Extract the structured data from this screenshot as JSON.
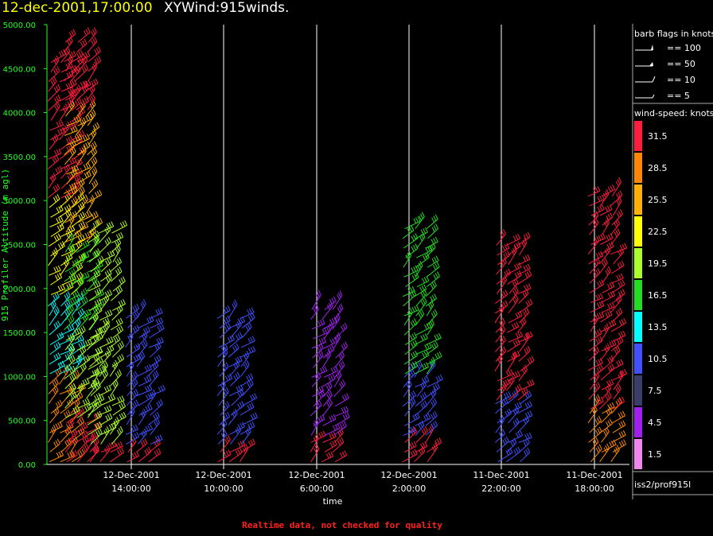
{
  "header": {
    "date": "12-dec-2001,17:00:00",
    "product": "XYWind:915winds."
  },
  "footer_note": "Realtime data, not checked for quality",
  "source": "iss2/prof915l",
  "legend": {
    "barb_title": "barb flags in knots",
    "barbs": [
      {
        "label": "== 100",
        "icon": "pennant"
      },
      {
        "label": "== 50",
        "icon": "triangle-flag"
      },
      {
        "label": "== 10",
        "icon": "full-barb"
      },
      {
        "label": "== 5",
        "icon": "half-barb"
      }
    ],
    "speed_title": "wind-speed: knots",
    "speed_bins": [
      {
        "label": "31.5",
        "color": "#ff1c3c"
      },
      {
        "label": "28.5",
        "color": "#ff8800"
      },
      {
        "label": "25.5",
        "color": "#ffb000"
      },
      {
        "label": "22.5",
        "color": "#ffff00"
      },
      {
        "label": "19.5",
        "color": "#aaff2a"
      },
      {
        "label": "16.5",
        "color": "#22dd22"
      },
      {
        "label": "13.5",
        "color": "#00ffff"
      },
      {
        "label": "10.5",
        "color": "#4050ff"
      },
      {
        "label": "7.5",
        "color": "#3c3c6c"
      },
      {
        "label": "4.5",
        "color": "#a020f0"
      },
      {
        "label": "1.5",
        "color": "#ee88ee"
      }
    ]
  },
  "chart_data": {
    "type": "scatter",
    "ylabel": "915 Profiler Altitude (m agl)",
    "xlabel": "time",
    "ylim": [
      0,
      5000
    ],
    "yticks": [
      "5000.00",
      "4500.00",
      "4000.00",
      "3500.00",
      "3000.00",
      "2500.00",
      "2000.00",
      "1500.00",
      "1000.00",
      "500.00",
      "0.00"
    ],
    "xticks": [
      {
        "date": "12-Dec-2001",
        "time": "14:00:00"
      },
      {
        "date": "12-Dec-2001",
        "time": "10:00:00"
      },
      {
        "date": "12-Dec-2001",
        "time": "6:00:00"
      },
      {
        "date": "12-Dec-2001",
        "time": "2:00:00"
      },
      {
        "date": "11-Dec-2001",
        "time": "22:00:00"
      },
      {
        "date": "11-Dec-2001",
        "time": "18:00:00"
      }
    ],
    "time_axis": "reversed, most recent at left",
    "grid": "vertical lines at tick times",
    "columns": [
      {
        "time": "17:00",
        "top_m": 4600,
        "bands": [
          [
            0,
            1000,
            "28.5"
          ],
          [
            1000,
            1900,
            "13.5"
          ],
          [
            1900,
            3000,
            "22.5"
          ],
          [
            3000,
            4600,
            "31.5"
          ]
        ]
      },
      {
        "time": "16:00",
        "top_m": 4900,
        "bands": [
          [
            0,
            500,
            "31.5"
          ],
          [
            500,
            1500,
            "19.5"
          ],
          [
            1500,
            2500,
            "16.5"
          ],
          [
            2500,
            4000,
            "25.5"
          ],
          [
            4000,
            4900,
            "31.5"
          ]
        ]
      },
      {
        "time": "15:00",
        "top_m": 2700,
        "bands": [
          [
            0,
            200,
            "31.5"
          ],
          [
            200,
            1500,
            "19.5"
          ],
          [
            1500,
            2700,
            "19.5"
          ]
        ]
      },
      {
        "time": "14:00",
        "top_m": 1700,
        "bands": [
          [
            0,
            200,
            "31.5"
          ],
          [
            200,
            1700,
            "10.5"
          ]
        ]
      },
      {
        "time": "10:00",
        "top_m": 1700,
        "bands": [
          [
            0,
            200,
            "31.5"
          ],
          [
            200,
            1700,
            "10.5"
          ]
        ]
      },
      {
        "time": "6:00",
        "top_m": 1800,
        "bands": [
          [
            0,
            300,
            "31.5"
          ],
          [
            300,
            1800,
            "4.5"
          ]
        ]
      },
      {
        "time": "2:00",
        "top_m": 2700,
        "bands": [
          [
            0,
            300,
            "31.5"
          ],
          [
            300,
            1000,
            "10.5"
          ],
          [
            1000,
            2700,
            "16.5"
          ]
        ]
      },
      {
        "time": "22:00",
        "top_m": 2600,
        "bands": [
          [
            0,
            700,
            "10.5"
          ],
          [
            700,
            2600,
            "31.5"
          ]
        ]
      },
      {
        "time": "18:00",
        "top_m": 3100,
        "bands": [
          [
            0,
            600,
            "28.5"
          ],
          [
            600,
            3100,
            "31.5"
          ]
        ]
      }
    ]
  }
}
